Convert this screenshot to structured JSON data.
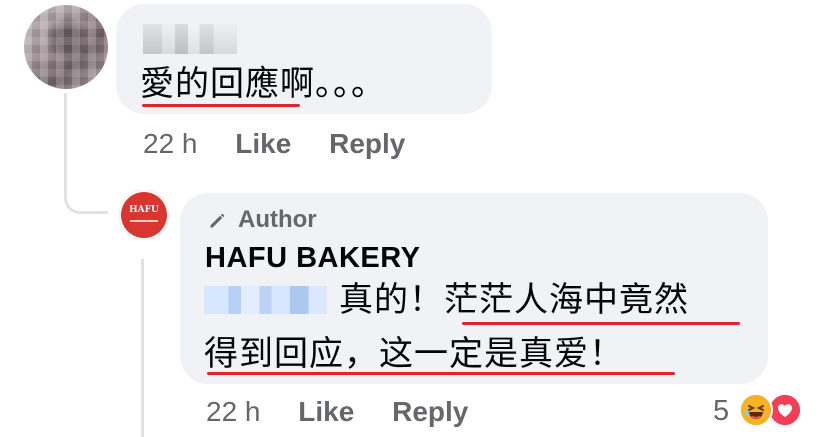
{
  "comment": {
    "text": "愛的回應啊。。。",
    "time": "22 h",
    "like_label": "Like",
    "reply_label": "Reply"
  },
  "reply": {
    "author_badge": "Author",
    "page_name": "HAFU BAKERY",
    "logo_text": "HAFU",
    "line1": "真的！茫茫人海中竟然",
    "line2": "得到回应，这一定是真爱！",
    "time": "22 h",
    "like_label": "Like",
    "reply_label": "Reply",
    "reaction_count": "5",
    "reaction_icons": [
      "laugh-icon",
      "heart-icon"
    ]
  },
  "colors": {
    "bubble": "#f0f2f5",
    "meta_text": "#65676b",
    "underline": "#e0242d",
    "brand": "#d8362f"
  }
}
